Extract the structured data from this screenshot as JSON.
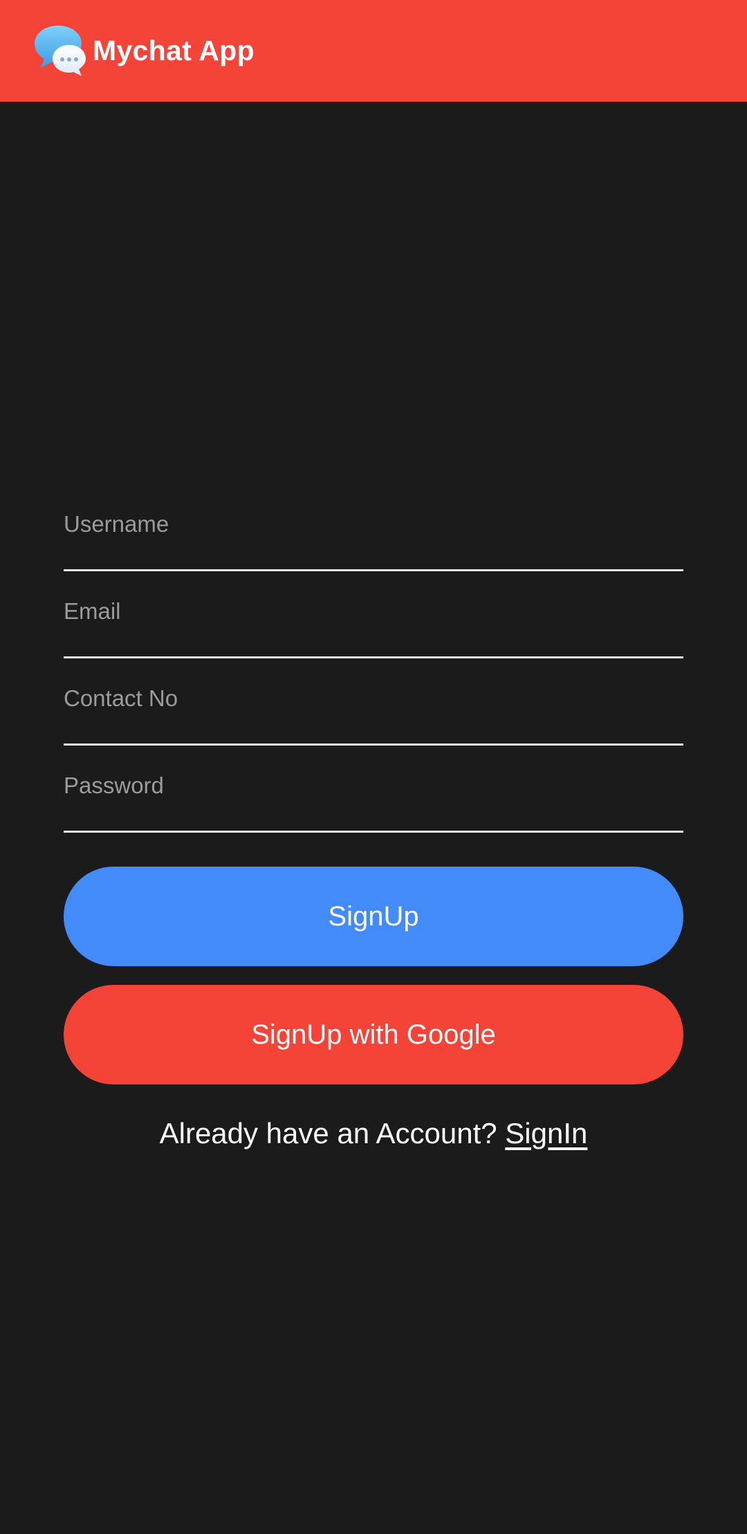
{
  "appbar": {
    "title": "Mychat App",
    "logo_icon": "chat-bubbles-icon",
    "background_color": "#f54337"
  },
  "form": {
    "username": {
      "placeholder": "Username",
      "value": ""
    },
    "email": {
      "placeholder": "Email",
      "value": ""
    },
    "contact": {
      "placeholder": "Contact No",
      "value": ""
    },
    "password": {
      "placeholder": "Password",
      "value": ""
    }
  },
  "buttons": {
    "signup_label": "SignUp",
    "signup_color": "#438afa",
    "google_label": "SignUp with Google",
    "google_color": "#f54337"
  },
  "footer": {
    "prompt": "Already have an Account?",
    "signin_label": "SignIn"
  },
  "theme": {
    "background": "#1b1b1b"
  }
}
